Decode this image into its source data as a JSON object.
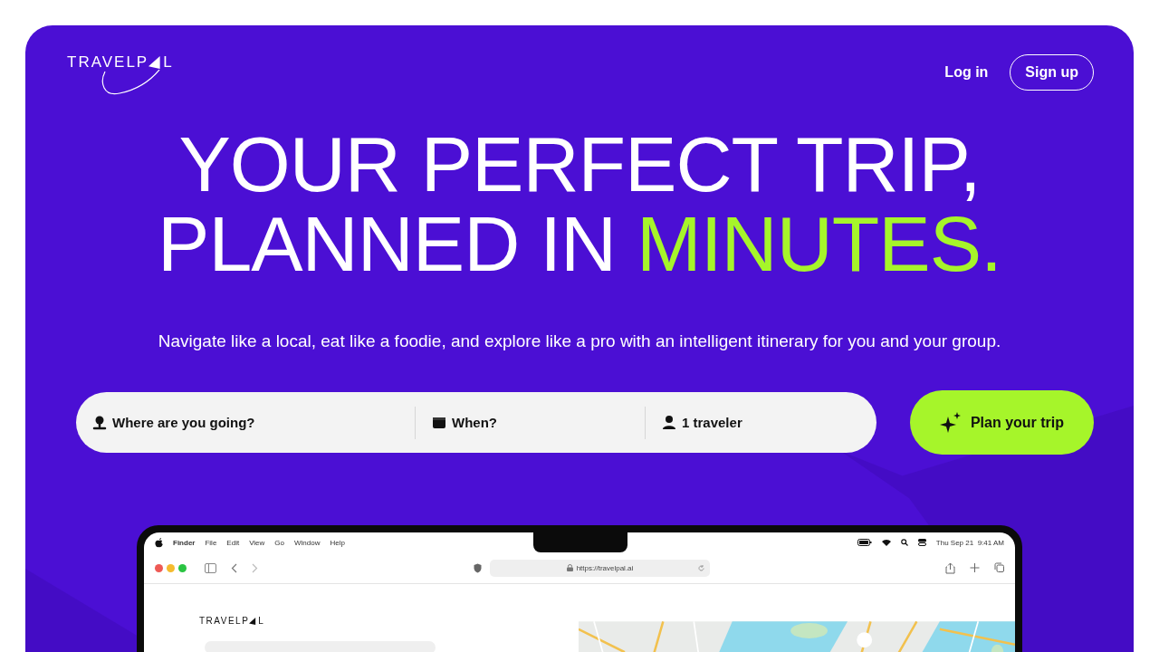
{
  "nav": {
    "logo": {
      "before": "TRAVELP",
      "after": "L"
    },
    "links": [
      {
        "label": "Log in",
        "kind": "plain"
      },
      {
        "label": "Sign up",
        "kind": "outline"
      }
    ]
  },
  "hero": {
    "headline": [
      "YOUR PERFECT TRIP,",
      "PLANNED IN **MINUTES.**"
    ],
    "subtitle": "Navigate like a local, eat like a foodie, and explore like a pro with an intelligent itinerary for you and your group."
  },
  "search": {
    "fields": [
      {
        "kind": "pin",
        "placeholder": "Where are you going?"
      },
      {
        "kind": "calendar",
        "placeholder": "When?"
      },
      {
        "kind": "person",
        "value": "1 traveler"
      }
    ],
    "button": "Plan your trip"
  },
  "laptop": {
    "menubar": {
      "items": [
        "Finder",
        "File",
        "Edit",
        "View",
        "Go",
        "Window",
        "Help"
      ],
      "clock": "Thu Sep 21  9:41 AM"
    },
    "browser": {
      "url": "https://travelpal.ai"
    },
    "page": {
      "logo": {
        "before": "TRAVELP",
        "after": "L"
      }
    }
  }
}
